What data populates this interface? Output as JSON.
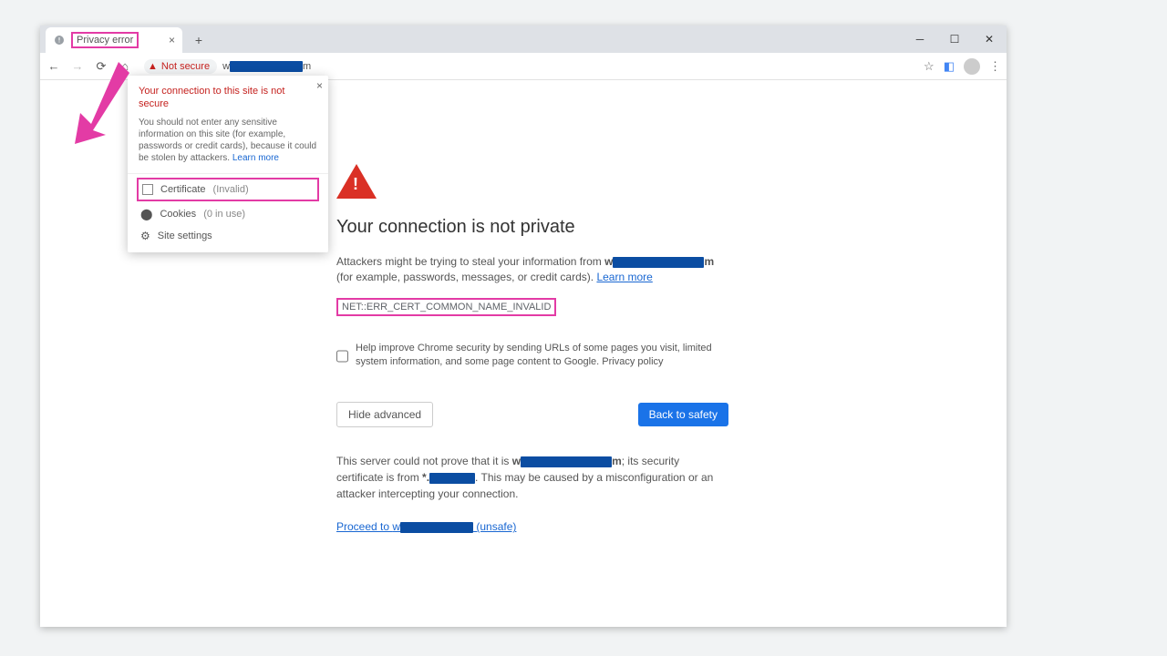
{
  "tab": {
    "title": "Privacy error"
  },
  "toolbar": {
    "not_secure": "Not secure",
    "url_prefix": "w",
    "url_suffix": "m"
  },
  "popover": {
    "title": "Your connection to this site is not secure",
    "body": "You should not enter any sensitive information on this site (for example, passwords or credit cards), because it could be stolen by attackers. ",
    "learn_more": "Learn more",
    "cert_label": "Certificate",
    "cert_status": "(Invalid)",
    "cookies_label": "Cookies",
    "cookies_status": "(0 in use)",
    "settings_label": "Site settings"
  },
  "page": {
    "heading": "Your connection is not private",
    "p1a": "Attackers might be trying to steal your information from ",
    "p1b": " (for example, passwords, messages, or credit cards). ",
    "learn_more": "Learn more",
    "error_code": "NET::ERR_CERT_COMMON_NAME_INVALID",
    "opt_a": "Help improve Chrome security by sending ",
    "opt_link1": "URLs of some pages you visit, limited system information, and some page content",
    "opt_b": " to Google. ",
    "opt_link2": "Privacy policy",
    "btn_hide": "Hide advanced",
    "btn_back": "Back to safety",
    "adv1a": "This server could not prove that it is ",
    "adv1b": "; its security certificate is from ",
    "adv1c": ". This may be caused by a misconfiguration or an attacker intercepting your connection.",
    "proceed_a": "Proceed to ",
    "proceed_b": " (unsafe)",
    "star_prefix": "*."
  },
  "redacted": {
    "domain_prefix": "w",
    "domain_suffix": "m"
  }
}
